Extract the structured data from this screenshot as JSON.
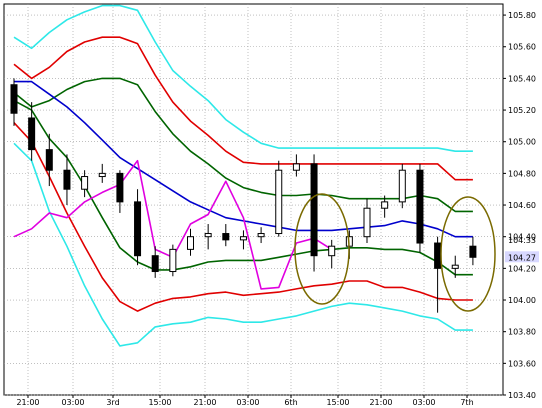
{
  "chart_data": {
    "type": "line",
    "x_ticks": [
      "21:00",
      "03:00",
      "3rd",
      "15:00",
      "21:00",
      "03:00",
      "6th",
      "15:00",
      "21:00",
      "03:00",
      "7th"
    ],
    "y_ticks": [
      "105.80",
      "105.60",
      "105.40",
      "105.20",
      "105.00",
      "104.80",
      "104.60",
      "104.40",
      "104.20",
      "104.00",
      "103.80",
      "103.60",
      "103.40"
    ],
    "ylim": [
      103.4,
      105.87
    ],
    "grid": true,
    "price_labels": {
      "current": "104.27",
      "indicator": "104.33"
    },
    "series": [
      {
        "color": "#2ee8e8",
        "values": [
          105.66,
          105.59,
          105.69,
          105.77,
          105.82,
          105.86,
          105.86,
          105.83,
          105.63,
          105.45,
          105.35,
          105.26,
          105.14,
          105.06,
          104.99,
          104.96,
          104.96,
          104.96,
          104.96,
          104.96,
          104.96,
          104.96,
          104.96,
          104.96,
          104.96,
          104.94,
          104.94
        ]
      },
      {
        "color": "#e00000",
        "values": [
          105.49,
          105.4,
          105.47,
          105.57,
          105.63,
          105.66,
          105.66,
          105.62,
          105.42,
          105.25,
          105.13,
          105.04,
          104.94,
          104.87,
          104.86,
          104.86,
          104.86,
          104.86,
          104.86,
          104.86,
          104.86,
          104.86,
          104.86,
          104.86,
          104.86,
          104.76,
          104.76
        ]
      },
      {
        "color": "#006400",
        "values": [
          105.31,
          105.22,
          105.26,
          105.33,
          105.38,
          105.4,
          105.4,
          105.36,
          105.19,
          105.05,
          104.94,
          104.86,
          104.77,
          104.71,
          104.68,
          104.66,
          104.66,
          104.67,
          104.66,
          104.64,
          104.64,
          104.64,
          104.64,
          104.66,
          104.64,
          104.56,
          104.56
        ]
      },
      {
        "color": "#0000cc",
        "values": [
          105.38,
          105.38,
          105.3,
          105.22,
          105.12,
          105.01,
          104.9,
          104.83,
          104.76,
          104.69,
          104.62,
          104.57,
          104.52,
          104.5,
          104.48,
          104.46,
          104.44,
          104.44,
          104.44,
          104.45,
          104.46,
          104.47,
          104.5,
          104.48,
          104.45,
          104.4,
          104.4
        ]
      },
      {
        "color": "#006400",
        "values": [
          105.26,
          105.2,
          105.02,
          104.9,
          104.72,
          104.52,
          104.33,
          104.24,
          104.19,
          104.19,
          104.21,
          104.24,
          104.25,
          104.25,
          104.25,
          104.27,
          104.29,
          104.31,
          104.32,
          104.33,
          104.33,
          104.32,
          104.32,
          104.3,
          104.24,
          104.16,
          104.16
        ]
      },
      {
        "color": "#e00000",
        "values": [
          105.12,
          105.0,
          104.78,
          104.55,
          104.34,
          104.14,
          103.99,
          103.93,
          103.98,
          104.01,
          104.02,
          104.04,
          104.05,
          104.03,
          104.04,
          104.05,
          104.07,
          104.09,
          104.1,
          104.12,
          104.12,
          104.08,
          104.08,
          104.05,
          104.01,
          104.0,
          104.0
        ]
      },
      {
        "color": "#2ee8e8",
        "values": [
          104.99,
          104.88,
          104.56,
          104.34,
          104.09,
          103.88,
          103.71,
          103.73,
          103.83,
          103.85,
          103.86,
          103.89,
          103.88,
          103.86,
          103.86,
          103.88,
          103.9,
          103.93,
          103.96,
          103.98,
          103.97,
          103.95,
          103.93,
          103.9,
          103.88,
          103.81,
          103.81
        ]
      },
      {
        "color": "#e000e0",
        "values": [
          104.4,
          104.45,
          104.55,
          104.52,
          104.62,
          104.68,
          104.73,
          104.88,
          104.32,
          104.27,
          104.48,
          104.54,
          104.75,
          104.52,
          104.07,
          104.08,
          104.36,
          104.39,
          104.32,
          null,
          null,
          null,
          null,
          null,
          null,
          null,
          null
        ]
      }
    ],
    "candles": [
      [
        105.36,
        105.4,
        105.1,
        105.18
      ],
      [
        105.15,
        105.25,
        104.88,
        104.95
      ],
      [
        104.95,
        105.05,
        104.72,
        104.82
      ],
      [
        104.82,
        104.92,
        104.6,
        104.7
      ],
      [
        104.7,
        104.82,
        104.65,
        104.78
      ],
      [
        104.78,
        104.86,
        104.74,
        104.8
      ],
      [
        104.8,
        104.82,
        104.55,
        104.62
      ],
      [
        104.62,
        104.7,
        104.22,
        104.28
      ],
      [
        104.28,
        104.34,
        104.14,
        104.18
      ],
      [
        104.18,
        104.35,
        104.15,
        104.32
      ],
      [
        104.32,
        104.45,
        104.28,
        104.4
      ],
      [
        104.4,
        104.48,
        104.32,
        104.42
      ],
      [
        104.42,
        104.48,
        104.34,
        104.38
      ],
      [
        104.38,
        104.44,
        104.32,
        104.4
      ],
      [
        104.4,
        104.46,
        104.36,
        104.42
      ],
      [
        104.42,
        104.88,
        104.4,
        104.82
      ],
      [
        104.82,
        104.92,
        104.78,
        104.86
      ],
      [
        104.86,
        104.92,
        104.18,
        104.28
      ],
      [
        104.28,
        104.38,
        104.2,
        104.34
      ],
      [
        104.34,
        104.44,
        104.26,
        104.4
      ],
      [
        104.4,
        104.64,
        104.36,
        104.58
      ],
      [
        104.58,
        104.66,
        104.52,
        104.62
      ],
      [
        104.62,
        104.86,
        104.58,
        104.82
      ],
      [
        104.82,
        104.86,
        104.3,
        104.36
      ],
      [
        104.36,
        104.4,
        103.92,
        104.2
      ],
      [
        104.2,
        104.28,
        104.14,
        104.22
      ],
      [
        104.34,
        104.4,
        104.22,
        104.27
      ]
    ]
  }
}
